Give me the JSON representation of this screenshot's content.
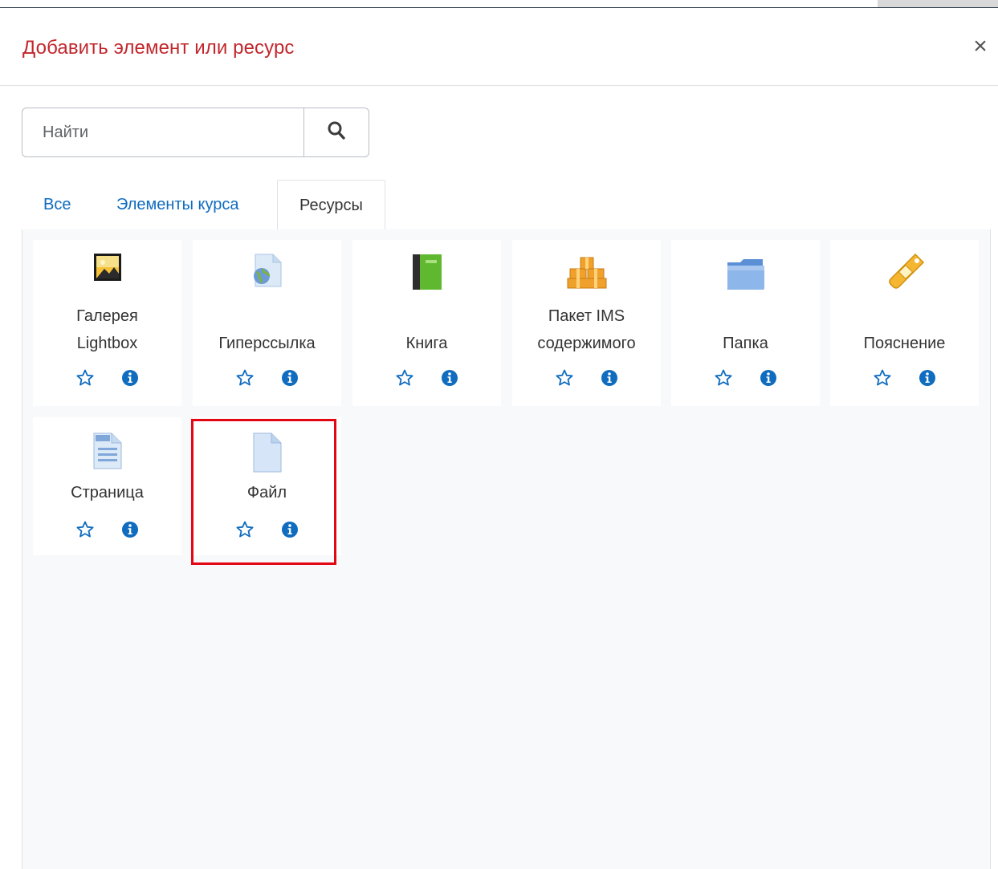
{
  "modal": {
    "title": "Добавить элемент или ресурс",
    "close_label": "×"
  },
  "search": {
    "placeholder": "Найти",
    "value": ""
  },
  "tabs": [
    {
      "label": "Все",
      "active": false
    },
    {
      "label": "Элементы курса",
      "active": false
    },
    {
      "label": "Ресурсы",
      "active": true
    }
  ],
  "items": [
    {
      "label_line1": "Галерея",
      "label_line2": "Lightbox",
      "icon": "image-gallery-icon"
    },
    {
      "label_line1": "",
      "label_line2": "Гиперссылка",
      "icon": "url-globe-icon"
    },
    {
      "label_line1": "",
      "label_line2": "Книга",
      "icon": "book-icon"
    },
    {
      "label_line1": "Пакет IMS",
      "label_line2": "содержимого",
      "icon": "package-boxes-icon"
    },
    {
      "label_line1": "",
      "label_line2": "Папка",
      "icon": "folder-icon"
    },
    {
      "label_line1": "",
      "label_line2": "Пояснение",
      "icon": "label-tag-icon"
    },
    {
      "label_line1": "",
      "label_line2": "Страница",
      "icon": "page-document-icon"
    },
    {
      "label_line1": "",
      "label_line2": "Файл",
      "icon": "file-icon"
    }
  ],
  "colors": {
    "title": "#c2272d",
    "link": "#0f6cbf",
    "highlight": "#e30613"
  }
}
